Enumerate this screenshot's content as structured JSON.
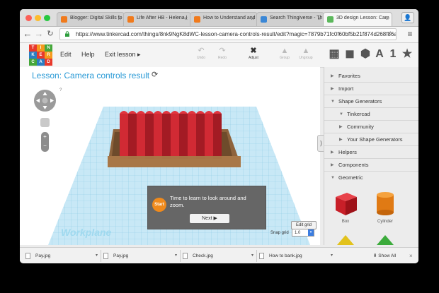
{
  "browser": {
    "tabs": [
      {
        "title": "Blogger: Digital Skills fo",
        "favicon_color": "#f07a1c"
      },
      {
        "title": "Life After HB - Helena I",
        "favicon_color": "#f07a1c"
      },
      {
        "title": "How to Understand and",
        "favicon_color": "#f07a1c"
      },
      {
        "title": "Search Thingiverse - Thi",
        "favicon_color": "#3a87d6"
      },
      {
        "title": "3D design Lesson: Cam",
        "favicon_color": "#5cb85c"
      }
    ],
    "url": "https://www.tinkercad.com/things/8nk9NgK8dWC-lesson-camera-controls-result/edit?magic=7879b71fc0f60bf5b21f874d268f86a"
  },
  "toolbar": {
    "logo_letters": [
      "TIN",
      "KER",
      "CAD"
    ],
    "menu": [
      {
        "label": "Edit"
      },
      {
        "label": "Help"
      },
      {
        "label": "Exit lesson ▸"
      }
    ],
    "tools": [
      {
        "label": "Undo",
        "icon": "undo-icon"
      },
      {
        "label": "Redo",
        "icon": "redo-icon"
      },
      {
        "label": "Adjust",
        "icon": "adjust-icon"
      },
      {
        "label": "Group",
        "icon": "group-icon"
      },
      {
        "label": "Ungroup",
        "icon": "ungroup-icon"
      }
    ],
    "views": [
      "grid-view-icon",
      "box-view-icon",
      "cube-view-icon",
      "A",
      "1",
      "★"
    ]
  },
  "canvas": {
    "lesson_title": "Lesson: Camera controls result",
    "workplane_label": "Workplane",
    "edit_grid": "Edit grid",
    "snap_grid_label": "Snap grid",
    "snap_grid_value": "1.0",
    "tooltip": {
      "badge": "Start",
      "message": "Time to learn to look around and zoom.",
      "next": "Next ▶"
    }
  },
  "panel": {
    "items": [
      {
        "label": "Favorites",
        "indent": 0,
        "open": false
      },
      {
        "label": "Import",
        "indent": 0,
        "open": false
      },
      {
        "label": "Shape Generators",
        "indent": 0,
        "open": true
      },
      {
        "label": "Tinkercad",
        "indent": 1,
        "open": true
      },
      {
        "label": "Community",
        "indent": 2,
        "open": false
      },
      {
        "label": "Your Shape Generators",
        "indent": 2,
        "open": false
      },
      {
        "label": "Helpers",
        "indent": 0,
        "open": false
      },
      {
        "label": "Components",
        "indent": 0,
        "open": false
      },
      {
        "label": "Geometric",
        "indent": 0,
        "open": true
      }
    ],
    "shapes": [
      {
        "label": "Box",
        "color": "#d9232e"
      },
      {
        "label": "Cylinder",
        "color": "#e8841f"
      }
    ]
  },
  "downloads": {
    "items": [
      "Pay.jpg",
      "Pay.jpg",
      "Check.jpg",
      "How to bank.jpg"
    ],
    "show_all": "Show All"
  }
}
